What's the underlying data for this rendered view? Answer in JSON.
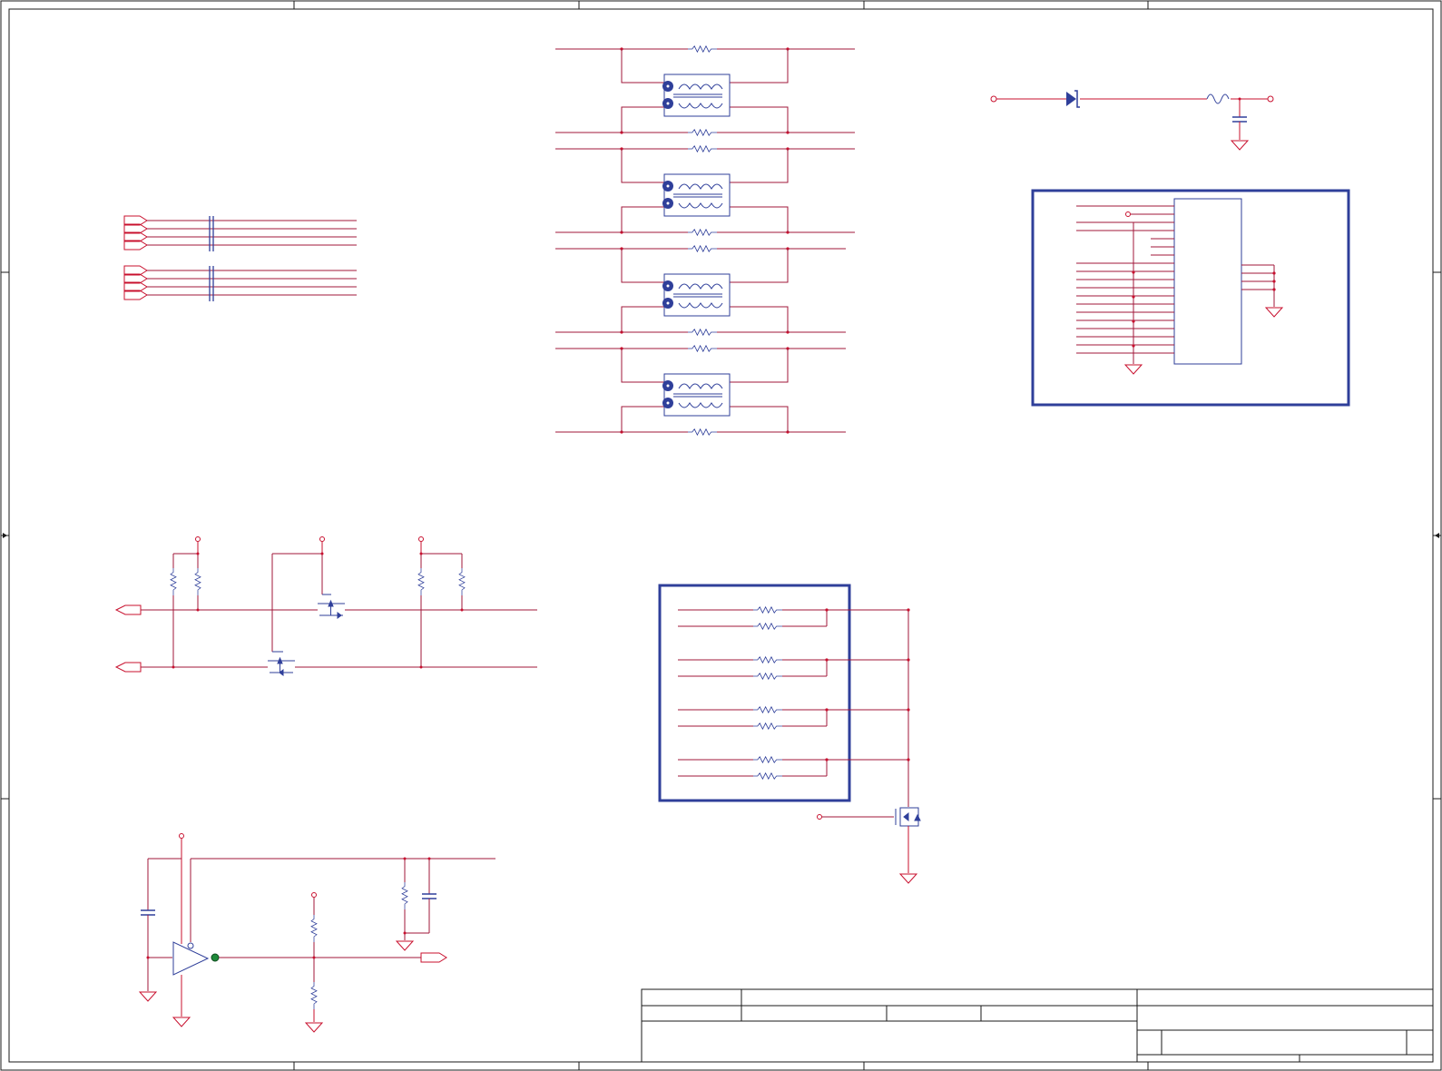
{
  "sheet": {
    "zone_columns": [
      "",
      "",
      "",
      "",
      ""
    ],
    "zone_rows": [
      "",
      "",
      ""
    ],
    "title_block": {
      "title": "",
      "document_number": "",
      "revision": "",
      "size": "",
      "date": "",
      "sheet_of": "",
      "company": ""
    }
  },
  "colors": {
    "wire": "#c8102e",
    "net": "#a0173a",
    "component": "#2f3f9a",
    "frame": "#1a1a1a",
    "junction_green": "#1f8a3a"
  },
  "circuits": [
    {
      "name": "magnetics-transformer-array",
      "transformers": 4,
      "termination_resistors": 8
    },
    {
      "name": "power-input-diode-inductor-filter"
    },
    {
      "name": "connector-header-block",
      "signal_pins": 20
    },
    {
      "name": "bus-connector-ports",
      "ports": 10
    },
    {
      "name": "i2c-level-shifter",
      "mosfets": 2,
      "pullups": 4
    },
    {
      "name": "led-resistor-array",
      "resistors": 8
    },
    {
      "name": "comparator-buffer-stage"
    }
  ]
}
